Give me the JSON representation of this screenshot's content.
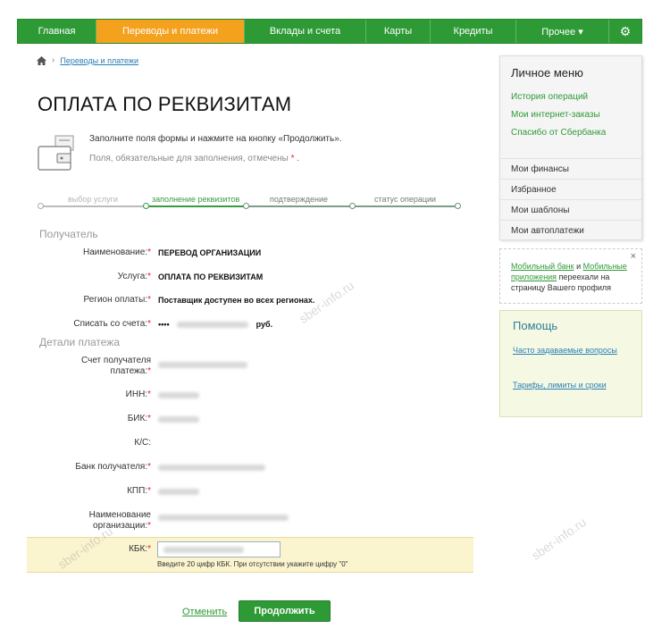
{
  "nav": {
    "items": [
      "Главная",
      "Переводы и платежи",
      "Вклады и счета",
      "Карты",
      "Кредиты",
      "Прочее ▾"
    ],
    "active_index": 1,
    "settings_icon": "gear-icon"
  },
  "breadcrumb": {
    "home_icon": "home-icon",
    "link": "Переводы и платежи"
  },
  "page": {
    "title": "ОПЛАТА ПО РЕКВИЗИТАМ",
    "intro_line1": "Заполните поля формы и нажмите на кнопку «Продолжить».",
    "intro_line2": "Поля, обязательные для заполнения, отмечены",
    "intro_req": " * ."
  },
  "steps": [
    "выбор услуги",
    "заполнение реквизитов",
    "подтверждение",
    "статус операции"
  ],
  "sections": {
    "recipient": "Получатель",
    "details": "Детали платежа"
  },
  "recipient": {
    "name_label": "Наименование:",
    "name_value": "ПЕРЕВОД ОРГАНИЗАЦИИ",
    "service_label": "Услуга:",
    "service_value": "ОПЛАТА ПО РЕКВИЗИТАМ",
    "region_label": "Регион оплаты:",
    "region_value": "Поставщик доступен во всех регионах.",
    "account_label": "Списать со счета:",
    "account_prefix": "••••",
    "account_suffix": "руб."
  },
  "details": {
    "account_label_1": "Счет получателя",
    "account_label_2": "платежа:",
    "inn_label": "ИНН:",
    "bik_label": "БИК:",
    "ks_label": "К/С:",
    "bank_label": "Банк получателя:",
    "kpp_label": "КПП:",
    "org_label_1": "Наименование",
    "org_label_2": "организации:",
    "kbk_label": "КБК:",
    "kbk_hint": "Введите 20 цифр КБК. При отсутствии укажите цифру \"0\""
  },
  "required_mark": "*",
  "actions": {
    "cancel": "Отменить",
    "continue": "Продолжить"
  },
  "side_menu": {
    "title": "Личное меню",
    "links": [
      "История операций",
      "Мои интернет-заказы",
      "Спасибо от Сбербанка"
    ],
    "groups": [
      "Мои финансы",
      "Избранное",
      "Мои шаблоны",
      "Мои автоплатежи"
    ]
  },
  "promo": {
    "link1": "Мобильный банк",
    "and": " и ",
    "link2": "Мобильные приложения",
    "rest": " переехали на страницу Вашего профиля",
    "close": "×"
  },
  "help": {
    "title": "Помощь",
    "links": [
      "Часто задаваемые вопросы",
      "Тарифы, лимиты и сроки"
    ]
  },
  "watermark": "sber-info.ru",
  "colors": {
    "brand_green": "#2e9a36",
    "active_orange": "#f4a11e",
    "required_red": "#e31e24",
    "kbk_highlight": "#faf4cf"
  }
}
